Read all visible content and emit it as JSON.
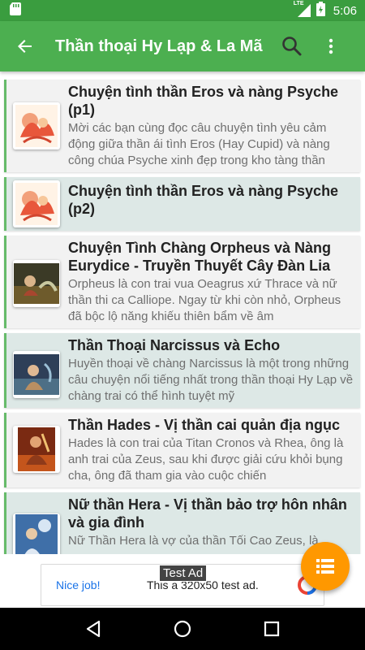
{
  "status_bar": {
    "time": "5:06",
    "network_label": "LTE"
  },
  "app_bar": {
    "title": "Thần thoại Hy Lạp & La Mã"
  },
  "articles": [
    {
      "title": "Chuyện tình thần Eros và nàng Psyche (p1)",
      "description": "Mời các bạn cùng đọc câu chuyện tình yêu cảm động giữa thần ái tình Eros (Hay Cupid) và nàng công chúa Psyche xinh đẹp trong kho tàng thần",
      "style": "light"
    },
    {
      "title": "Chuyện tình thần Eros và nàng Psyche (p2)",
      "description": "",
      "style": "teal"
    },
    {
      "title": "Chuyện Tình Chàng Orpheus và Nàng Eurydice - Truyền Thuyết Cây Đàn Lia",
      "description": "Orpheus là con trai vua Oeagrus xứ Thrace và nữ thần thi ca Calliope. Ngay từ khi còn nhỏ, Orpheus đã bộc lộ năng khiếu thiên bẩm về âm",
      "style": "light"
    },
    {
      "title": "Thần Thoại Narcissus và Echo",
      "description": "Huyền thoại về chàng Narcissus là một trong những câu chuyện nổi tiếng nhất trong thần thoại Hy Lạp về chàng trai có thể hình tuyệt mỹ",
      "style": "teal"
    },
    {
      "title": "Thần Hades - Vị thần cai quản địa ngục",
      "description": "Hades là con trai của Titan Cronos và Rhea, ông là anh trai của Zeus, sau khi được giải cứu khỏi bụng cha, ông đã tham gia vào cuộc chiến",
      "style": "light"
    },
    {
      "title": "Nữ thần Hera - Vị thần bảo trợ hôn nhân và gia đình",
      "description": "Nữ Thần Hera là vợ của thần Tối Cao Zeus, là",
      "style": "teal"
    }
  ],
  "ad": {
    "tag": "Test Ad",
    "nice_job": "Nice job!",
    "message": "This a 320x50 test ad."
  },
  "colors": {
    "app_bar": "#4caf50",
    "status_bar": "#3a9d3f",
    "fab": "#ff9800",
    "card_border": "#66bb6a"
  }
}
